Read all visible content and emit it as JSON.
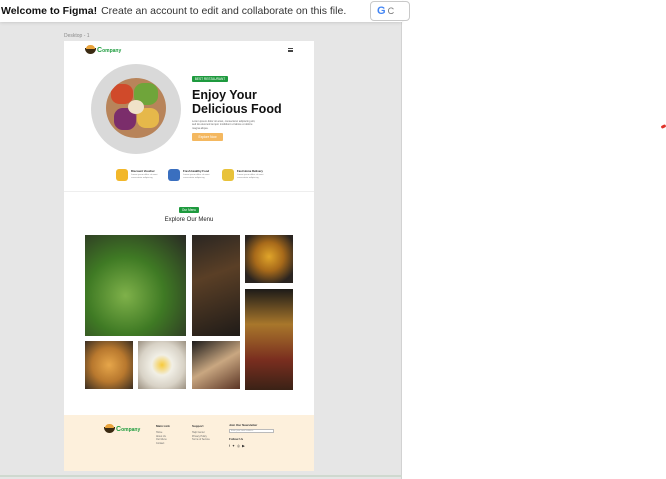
{
  "banner": {
    "title": "Welcome to Figma!",
    "message": "Create an account to edit and collaborate on this file.",
    "google_icon": "G",
    "google_text": "C"
  },
  "canvas": {
    "frame_label": "Desktop - 1"
  },
  "site": {
    "logo": {
      "initial": "C",
      "name": "ompany"
    },
    "nav_icon": "hamburger-menu-icon",
    "hero": {
      "badge": "BEST RESTAURANT",
      "title_line1": "Enjoy Your",
      "title_line2": "Delicious Food",
      "description": "Lorem ipsum dolor sit amet, consectetur adipiscing elit, sed do eiusmod tempor incididunt ut labore et dolore magna aliqua.",
      "button": "Explore Now"
    },
    "features": [
      {
        "title": "Discount Voucher",
        "desc": "Lorem ipsum dolor sit amet consectetur adipiscing",
        "icon": "voucher-icon",
        "color": "#f2b72a"
      },
      {
        "title": "Fresh Healthy Food",
        "desc": "Lorem ipsum dolor sit amet consectetur adipiscing",
        "icon": "basket-icon",
        "color": "#3a6fbf"
      },
      {
        "title": "Fast Home Delivery",
        "desc": "Lorem ipsum dolor sit amet consectetur adipiscing",
        "icon": "delivery-icon",
        "color": "#e8c23a"
      }
    ],
    "menu_section": {
      "badge": "Our Menu",
      "title": "Explore Our Menu"
    },
    "footer": {
      "col1_title": "Main Link",
      "col1_links": [
        "Home",
        "About Us",
        "Our Menu",
        "Contact"
      ],
      "col2_title": "Support",
      "col2_links": [
        "Help Center",
        "Privacy Policy",
        "Terms of Service"
      ],
      "col3_title": "Join Our Newsletter",
      "newsletter_placeholder": "Enter your email address",
      "follow_title": "Follow Us",
      "social": [
        "f",
        "✦",
        "◎",
        "▶"
      ]
    }
  },
  "colors": {
    "brand_green": "#1e9a3e",
    "accent_orange": "#f4b860",
    "footer_bg": "#fdf0dc"
  }
}
